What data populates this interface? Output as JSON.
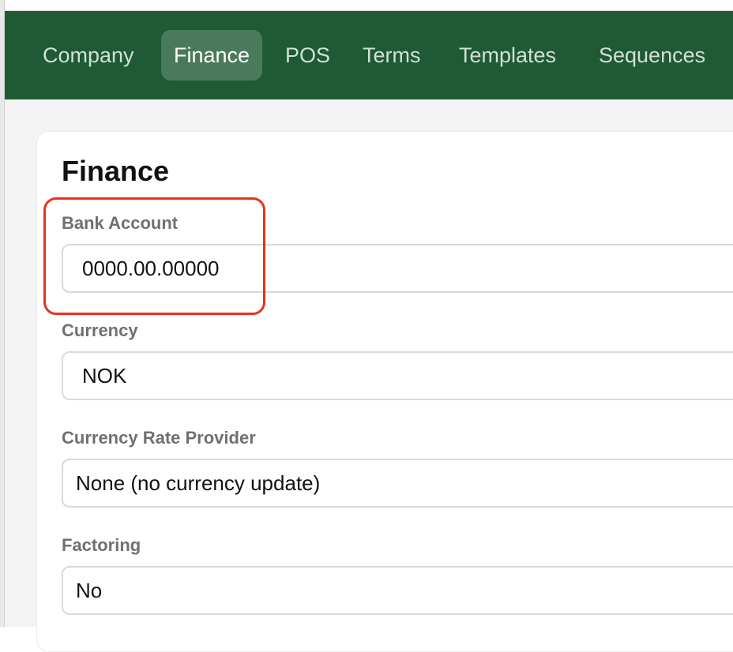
{
  "nav": {
    "tabs": [
      {
        "label": "Company",
        "active": false
      },
      {
        "label": "Finance",
        "active": true
      },
      {
        "label": "POS",
        "active": false
      },
      {
        "label": "Terms",
        "active": false
      },
      {
        "label": "Templates",
        "active": false
      },
      {
        "label": "Sequences",
        "active": false
      }
    ]
  },
  "section": {
    "title": "Finance"
  },
  "fields": {
    "bank_account": {
      "label": "Bank Account",
      "value": "0000.00.00000"
    },
    "currency": {
      "label": "Currency",
      "value": "NOK"
    },
    "currency_rate_provider": {
      "label": "Currency Rate Provider",
      "value": "None (no currency update)"
    },
    "factoring": {
      "label": "Factoring",
      "value": "No"
    }
  },
  "colors": {
    "nav_background": "#1f5a35",
    "nav_active_tab": "#4b7a5a",
    "highlight": "#e8321f"
  }
}
